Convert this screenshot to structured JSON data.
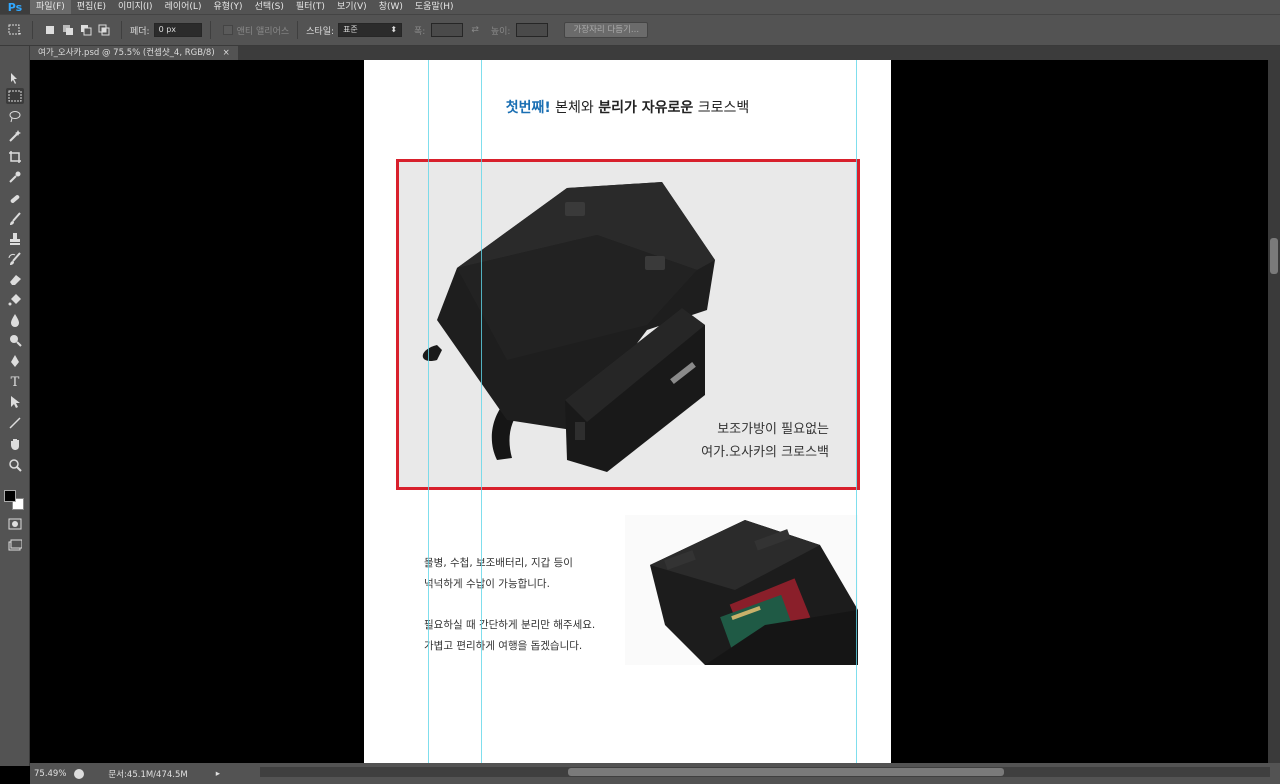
{
  "app": {
    "logo": "Ps"
  },
  "menu": [
    {
      "label": "파일(F)",
      "active": true
    },
    {
      "label": "편집(E)"
    },
    {
      "label": "이미지(I)"
    },
    {
      "label": "레이어(L)"
    },
    {
      "label": "유형(Y)"
    },
    {
      "label": "선택(S)"
    },
    {
      "label": "필터(T)"
    },
    {
      "label": "보기(V)"
    },
    {
      "label": "창(W)"
    },
    {
      "label": "도움말(H)"
    }
  ],
  "options": {
    "feather_label": "페더:",
    "feather_value": "0 px",
    "antialias_label": "앤티 앨리어스",
    "style_label": "스타일:",
    "style_value": "표준",
    "width_label": "폭:",
    "height_label": "높이:",
    "refine_edge_label": "가장자리 다듬기..."
  },
  "document_tab": {
    "title": "여가_오사카.psd @ 75.5% (컨셉샷_4, RGB/8)",
    "close": "×"
  },
  "canvas": {
    "headline": {
      "accent": "첫번째!",
      "part1": " 본체와 ",
      "bold": "분리가 자유로운",
      "part2": " 크로스백"
    },
    "caption_line1": "보조가방이 필요없는",
    "caption_line2": "여가.오사카의 크로스백",
    "body_lines": [
      "물병, 수첩, 보조배터리, 지갑 등이",
      "넉넉하게 수납이 가능합니다.",
      "필요하실 때 간단하게 분리만 해주세요.",
      "가볍고 편리하게 여행을 돕겠습니다."
    ]
  },
  "status": {
    "zoom": "75.49%",
    "doc_info": "문서:45.1M/474.5M"
  },
  "colors": {
    "highlight_frame": "#d8202c",
    "headline_accent": "#1a6fb3",
    "guides": "#5fd6e8"
  }
}
